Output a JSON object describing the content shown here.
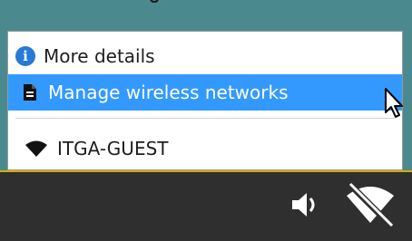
{
  "menu": {
    "items": [
      {
        "label": "More details",
        "icon": "info-icon"
      },
      {
        "label": "Manage wireless networks",
        "icon": "document-icon"
      },
      {
        "label": "ITGA-GUEST",
        "icon": "wifi-signal-icon"
      }
    ]
  },
  "tray": {
    "icons": [
      "speaker-icon",
      "wireless-disconnected-icon"
    ]
  },
  "colors": {
    "highlight": "#3399ff",
    "taskbar": "#2f2f2f",
    "desktop": "#4a8a8e",
    "taskbar_border": "#d0b000"
  }
}
